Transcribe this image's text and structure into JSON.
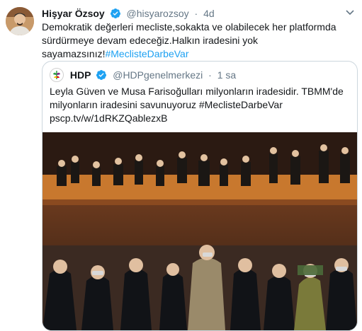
{
  "tweet": {
    "author_name": "Hişyar Özsoy",
    "author_handle": "@hisyarozsoy",
    "separator": "·",
    "time": "4d",
    "text_main": "Demokratik değerleri mecliste,sokakta ve olabilecek her platformda sürdürmeye devam edeceğiz.Halkın iradesini yok sayamazsınız!",
    "hashtag": "#MeclisteDarbeVar",
    "avatar_icon": "user-avatar",
    "verified_icon": "verified-badge-icon",
    "caret_icon": "chevron-down-icon"
  },
  "quoted": {
    "author_name": "HDP",
    "author_handle": "@HDPgenelmerkezi",
    "separator": "·",
    "time": "1 sa",
    "text": "Leyla Güven ve Musa Farisoğulları milyonların iradesidir. TBMM'de milyonların iradesini savunuyoruz #MeclisteDarbeVar pscp.tv/w/1dRKZQablezxB",
    "photo_icon": "parliament-photo"
  },
  "colors": {
    "accent": "#1da1f2",
    "secondary_text": "#657786",
    "border": "#ccd6dd"
  }
}
